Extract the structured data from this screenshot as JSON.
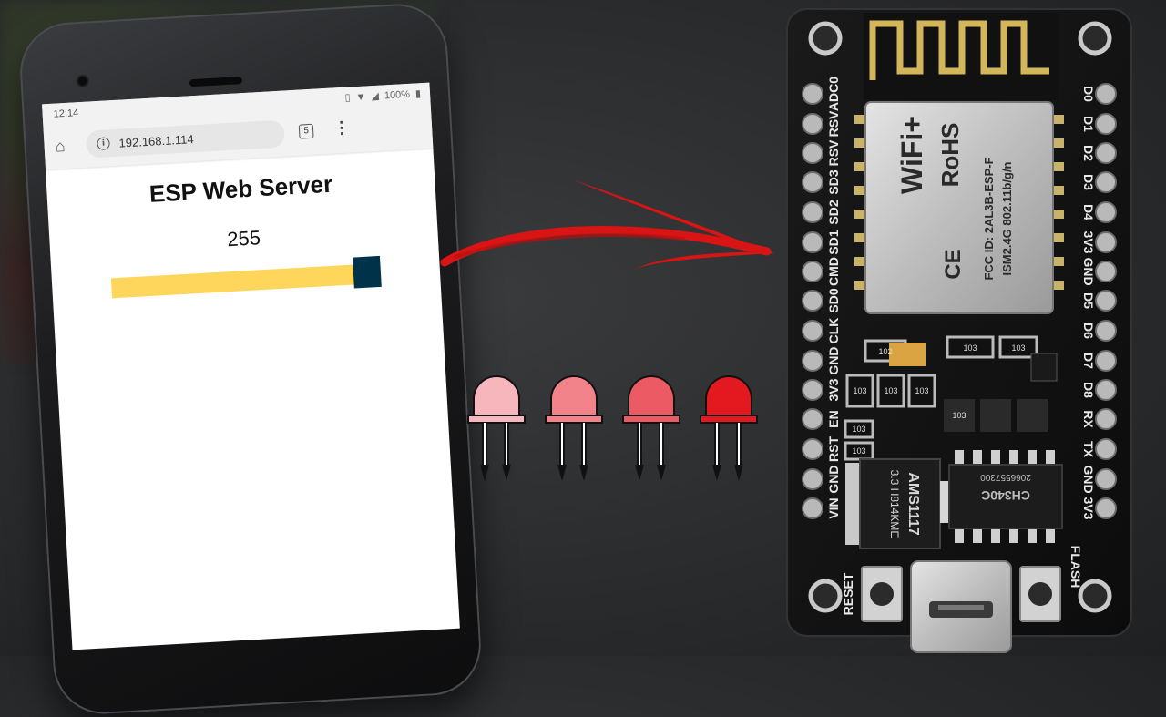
{
  "phone": {
    "status_time": "12:14",
    "battery": "100%",
    "url": "192.168.1.114",
    "tab_count": "5"
  },
  "webpage": {
    "title": "ESP Web Server",
    "slider_value": "255",
    "slider_min": 0,
    "slider_max": 255,
    "slider_color": "#ffd65c",
    "thumb_color": "#003249"
  },
  "leds": [
    {
      "color": "#f7b6bb"
    },
    {
      "color": "#f2838b"
    },
    {
      "color": "#ec5a63"
    },
    {
      "color": "#e3191f"
    }
  ],
  "board": {
    "left_pins": [
      "ADC0",
      "RSV",
      "RSV",
      "SD3",
      "SD2",
      "SD1",
      "CMD",
      "SD0",
      "CLK",
      "GND",
      "3V3",
      "EN",
      "RST",
      "GND",
      "VIN"
    ],
    "right_pins": [
      "D0",
      "D1",
      "D2",
      "D3",
      "D4",
      "3V3",
      "GND",
      "D5",
      "D6",
      "D7",
      "D8",
      "RX",
      "TX",
      "GND",
      "3V3"
    ],
    "module_brand": "WiFi+",
    "module_rohs": "RoHS",
    "module_fcc": "FCC ID: 2AL3B-ESP-F",
    "module_band": "ISM2.4G 802.11b/g/n",
    "regulator": "AMS1117",
    "regulator_sub": "3.3 H814KME",
    "usb_chip": "CH340C",
    "usb_chip_code": "2066557300",
    "reset_label": "RESET",
    "flash_label": "FLASH",
    "resistor_codes": [
      "102",
      "103",
      "103",
      "103",
      "103",
      "103",
      "103",
      "103",
      "103"
    ]
  },
  "arrow_color": "#d81414"
}
